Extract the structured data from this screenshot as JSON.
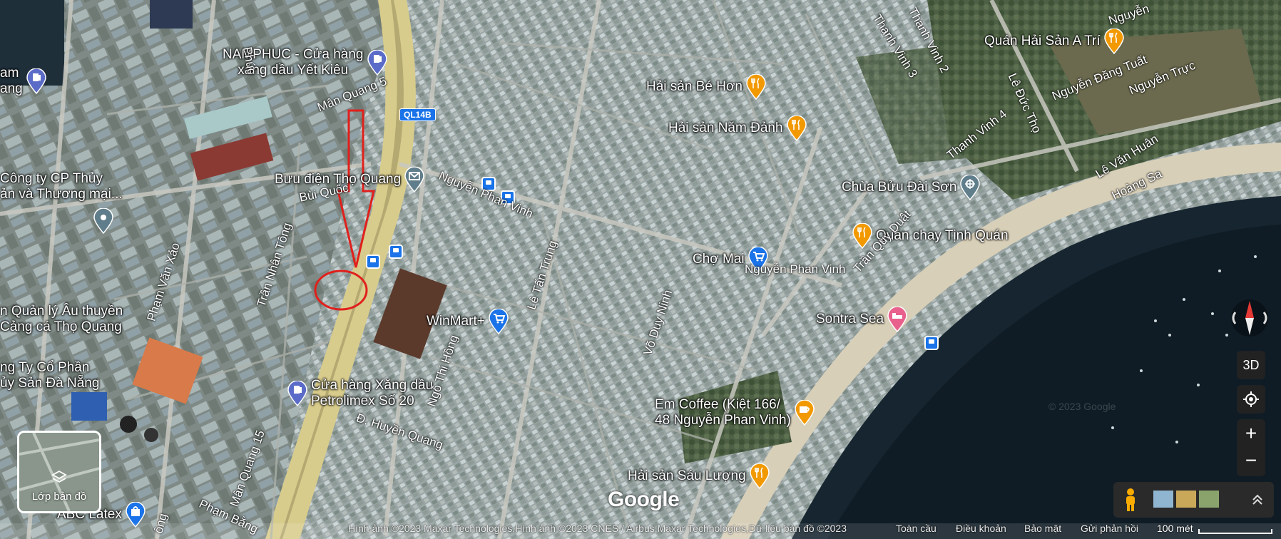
{
  "map": {
    "pois": [
      {
        "id": "namphuc",
        "label": "NAMPHUC - Cửa hàng\nxăng dầu Yết Kiêu",
        "icon": "gas-station-icon",
        "color": "#5b6bc8"
      },
      {
        "id": "buu-dien",
        "label": "Bưu điện Thọ Quang",
        "icon": "post-office-icon",
        "color": "#607d8b"
      },
      {
        "id": "cty-thuy",
        "label": "Công ty CP Thủy\nản và Thương mại...",
        "icon": "business-icon",
        "color": "#607d8b"
      },
      {
        "id": "quan-ly",
        "label": "n Quản lý Âu thuyền\nCảng cá Thọ Quang",
        "icon": "none",
        "color": "#607d8b"
      },
      {
        "id": "cong-ty-co-phan",
        "label": "ng Ty Cổ Phần\nủy Sản Đà Nẵng",
        "icon": "none",
        "color": "#607d8b"
      },
      {
        "id": "petrolimex",
        "label": "Cửa hàng Xăng dầu\nPetrolimex Số 20",
        "icon": "gas-station-icon",
        "color": "#5b6bc8"
      },
      {
        "id": "winmart",
        "label": "WinMart+",
        "icon": "shopping-cart-icon",
        "color": "#1a73e8"
      },
      {
        "id": "abc-latex",
        "label": "ABC Latex",
        "icon": "shopping-bag-icon",
        "color": "#1a73e8"
      },
      {
        "id": "hai-san-be-hon",
        "label": "Hải sản Bé Hơn",
        "icon": "restaurant-icon",
        "color": "#f29900"
      },
      {
        "id": "hai-san-nam-danh",
        "label": "Hải sản Năm Đảnh",
        "icon": "restaurant-icon",
        "color": "#f29900"
      },
      {
        "id": "quan-hai-san-a-tri",
        "label": "Quán Hải Sản A Trí",
        "icon": "restaurant-icon",
        "color": "#f29900"
      },
      {
        "id": "chua-buu-dai-son",
        "label": "Chùa Bửu Đài Sơn",
        "icon": "temple-icon",
        "color": "#607d8b"
      },
      {
        "id": "quan-chay",
        "label": "Quán chay Tịnh Quán",
        "icon": "restaurant-icon",
        "color": "#f29900"
      },
      {
        "id": "cho-mai",
        "label": "Chợ Mai",
        "icon": "shopping-cart-icon",
        "color": "#1a73e8"
      },
      {
        "id": "sontra-sea",
        "label": "Sontra Sea",
        "icon": "hotel-icon",
        "color": "#e8618c"
      },
      {
        "id": "em-coffee",
        "label": "Em Coffee (Kiệt 166/\n48 Nguyễn Phan Vinh)",
        "icon": "cafe-icon",
        "color": "#f29900"
      },
      {
        "id": "hai-san-sau-luong",
        "label": "Hải sản Sáu Lượng",
        "icon": "restaurant-icon",
        "color": "#f29900"
      },
      {
        "id": "am",
        "label": "am\nang",
        "icon": "gas-station-icon",
        "color": "#5b6bc8"
      }
    ],
    "roads": [
      {
        "id": "man-quang-5",
        "label": "Mân Quang 5"
      },
      {
        "id": "nguyen-phan-vinh-1",
        "label": "Nguyễn Phan Vinh"
      },
      {
        "id": "nguyen-phan-vinh-2",
        "label": "Nguyễn Phan Vinh"
      },
      {
        "id": "bui-quoc",
        "label": "Bùi Quốc"
      },
      {
        "id": "tran-nhan-tong",
        "label": "Trần Nhân Tông"
      },
      {
        "id": "pham-van-xao",
        "label": "Phạm Văn Xảo"
      },
      {
        "id": "le-tan-trung",
        "label": "Lê Tấn Trung"
      },
      {
        "id": "vo-duy-ninh",
        "label": "Võ Duy Ninh"
      },
      {
        "id": "ngo-thi-hong",
        "label": "Ngô Thị Hồng"
      },
      {
        "id": "huyen-quang",
        "label": "Đ. Huyền Quang"
      },
      {
        "id": "man-quang-15",
        "label": "Mân Quang 15"
      },
      {
        "id": "pham-bang",
        "label": "Phạm Bằng"
      },
      {
        "id": "thanh-vinh-3",
        "label": "Thanh Vinh 3"
      },
      {
        "id": "thanh-vinh-2",
        "label": "Thanh Vinh 2"
      },
      {
        "id": "thanh-vinh-4",
        "label": "Thanh Vinh 4"
      },
      {
        "id": "le-duc-tho",
        "label": "Lê Đức Thọ"
      },
      {
        "id": "tran-quy-duat",
        "label": "Trần Quý Duật"
      },
      {
        "id": "le-van-huan",
        "label": "Lê Văn Huân"
      },
      {
        "id": "hoang-sa",
        "label": "Hoàng Sa"
      },
      {
        "id": "nguyen-dang-tuat",
        "label": "Nguyễn Đăng Tuất"
      },
      {
        "id": "nguyen-truc",
        "label": "Nguyễn Trực"
      },
      {
        "id": "nguyen-top",
        "label": "Nguyễn"
      },
      {
        "id": "phuc",
        "label": "Phúc"
      },
      {
        "id": "ong",
        "label": "ông"
      }
    ],
    "highway_shield": "QL14B",
    "layer_button_label": "Lớp bản đồ",
    "google_logo": "Google",
    "attribution": "Hình ảnh ©2023 Maxar Technologies,Hình ảnh ©2023 CNES / Airbus,Maxar Technologies,Dữ liệu bản đồ ©2023",
    "footer_links": [
      "Toàn cầu",
      "Điều khoản",
      "Bảo mật",
      "Gửi phản hồi"
    ],
    "scale_label": "100 mét",
    "controls": {
      "three_d": "3D",
      "zoom_in": "+",
      "zoom_out": "−"
    },
    "watermark": "© 2023 Google"
  }
}
